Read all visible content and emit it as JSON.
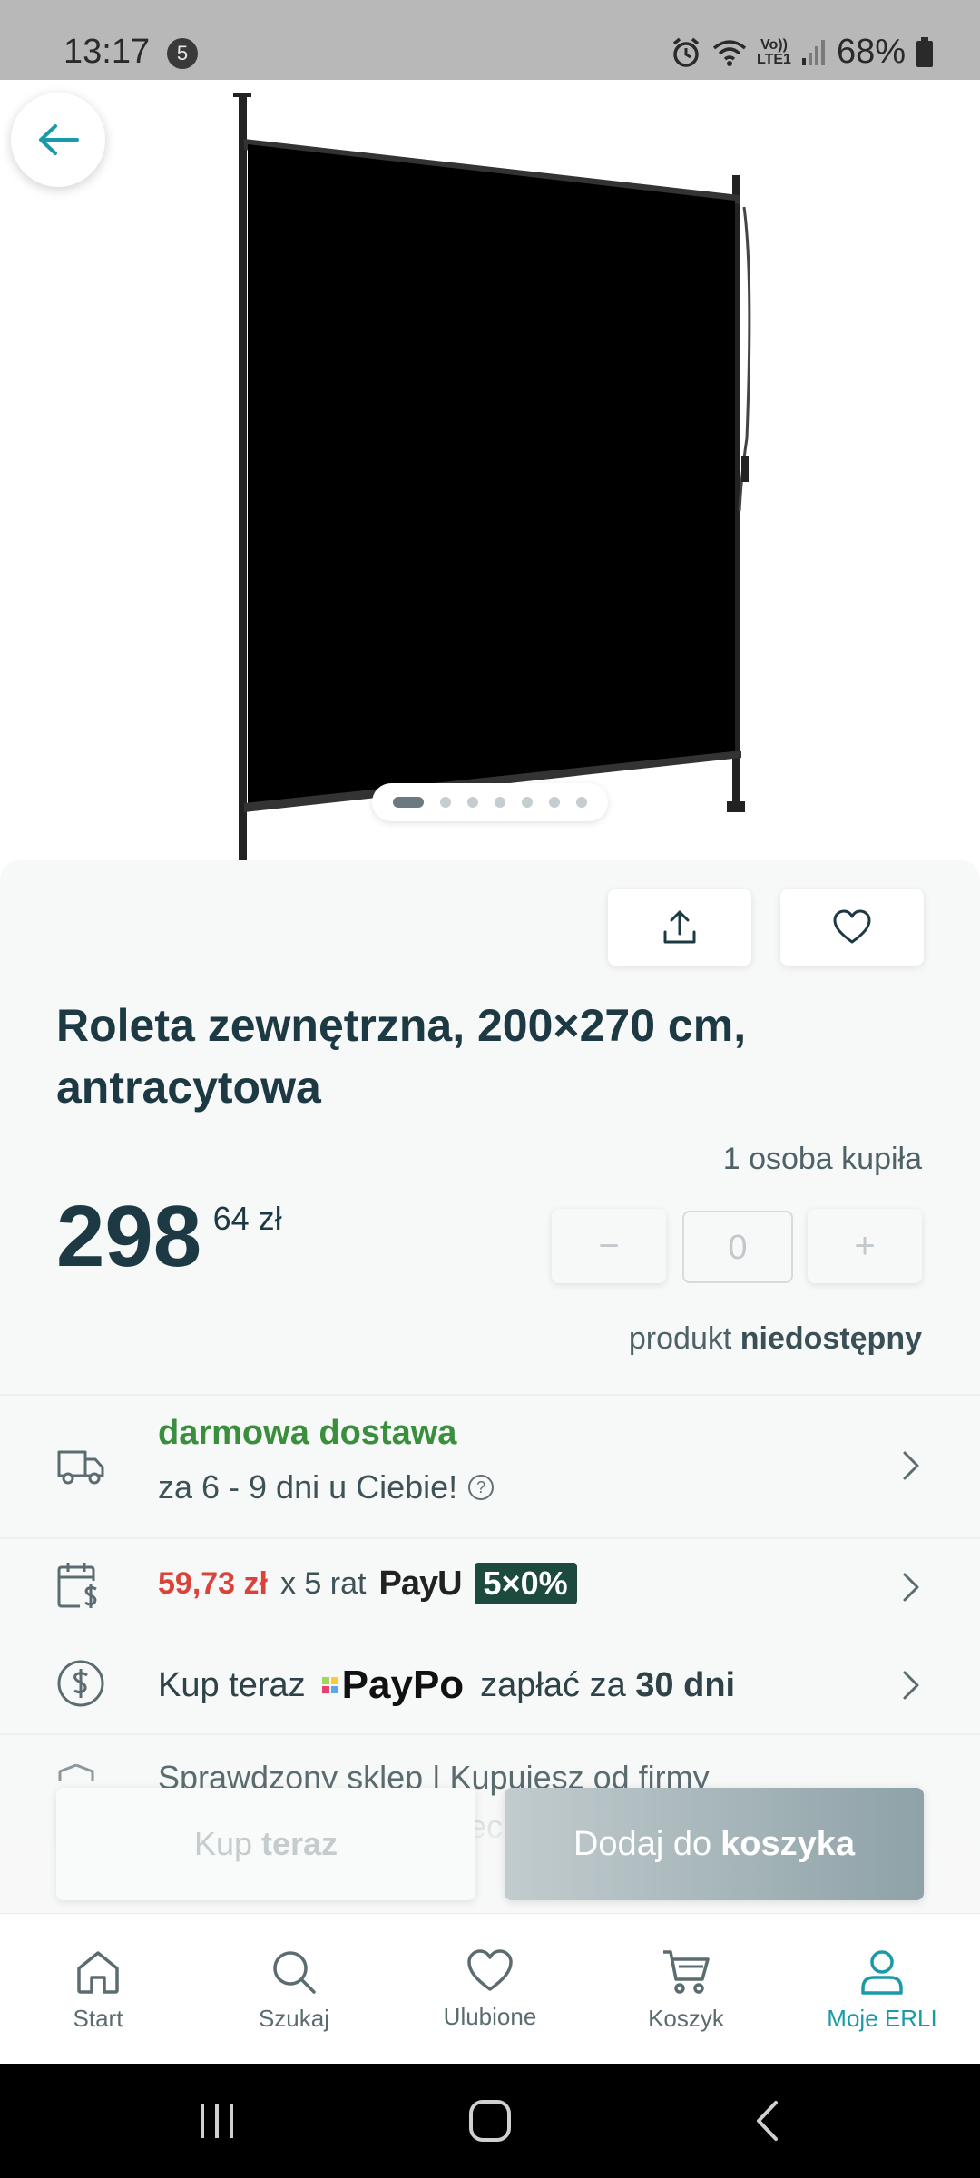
{
  "status_bar": {
    "time": "13:17",
    "notification_count": "5",
    "network_label_top": "Vo))",
    "network_label_bottom": "LTE1",
    "battery": "68%"
  },
  "product": {
    "title": "Roleta zewnętrzna, 200×270 cm, antracytowa",
    "buyers": "1 osoba kupiła",
    "price_int": "298",
    "price_dec": "64 zł",
    "quantity_value": "0",
    "stepper_minus": "−",
    "stepper_plus": "+",
    "availability_prefix": "produkt",
    "availability_status": "niedostępny",
    "image_count": 7,
    "image_active": 1
  },
  "delivery": {
    "title": "darmowa dostawa",
    "subtitle": "za 6 - 9 dni u Ciebie!",
    "help": "?"
  },
  "installments": {
    "amount": "59,73 zł",
    "count_text": "x 5 rat",
    "provider": "PayU",
    "badge": "5×0%"
  },
  "paypo": {
    "prefix": "Kup teraz",
    "provider": "PayPo",
    "suffix_a": "zapłać za",
    "suffix_b": "30 dni"
  },
  "verified": {
    "line1": "Sprawdzony sklep | Kupujesz od firmy",
    "line2": "ec"
  },
  "cta": {
    "buy_now_a": "Kup",
    "buy_now_b": "teraz",
    "add_cart_a": "Dodaj do",
    "add_cart_b": "koszyka"
  },
  "nav": {
    "start": "Start",
    "search": "Szukaj",
    "favorites": "Ulubione",
    "cart": "Koszyk",
    "account": "Moje ERLI"
  },
  "colors": {
    "accent": "#1a9aa8",
    "text_dark": "#1d3a44",
    "delivery_green": "#3a8f3c",
    "installment_red": "#d9433a",
    "badge_green": "#1d4a3e"
  }
}
